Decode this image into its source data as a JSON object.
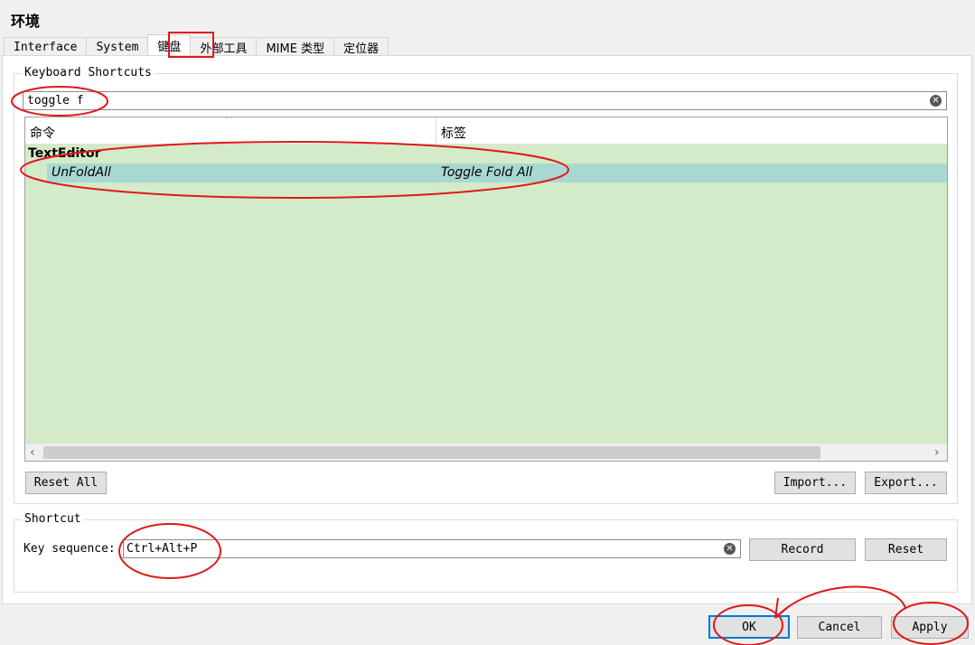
{
  "window": {
    "title": "环境"
  },
  "tabs": [
    {
      "label": "Interface",
      "active": false
    },
    {
      "label": "System",
      "active": false
    },
    {
      "label": "键盘",
      "active": true
    },
    {
      "label": "外部工具",
      "active": false
    },
    {
      "label": "MIME 类型",
      "active": false
    },
    {
      "label": "定位器",
      "active": false
    }
  ],
  "shortcuts_group": {
    "title": "Keyboard Shortcuts",
    "search_value": "toggle f",
    "columns": [
      "命令",
      "标签"
    ],
    "tree": {
      "group": "TextEditor",
      "rows": [
        {
          "command": "UnFoldAll",
          "label": "Toggle Fold All",
          "selected": true
        }
      ]
    },
    "reset_all": "Reset All",
    "import": "Import...",
    "export": "Export..."
  },
  "shortcut_group": {
    "title": "Shortcut",
    "key_sequence_label": "Key sequence:",
    "key_sequence_value": "Ctrl+Alt+P",
    "record": "Record",
    "reset": "Reset"
  },
  "dialog_buttons": {
    "ok": "OK",
    "cancel": "Cancel",
    "apply": "Apply"
  },
  "colors": {
    "tree_bg": "#d3ebc8",
    "selected_row": "#a8d8d2",
    "annotation": "#e01818",
    "focus_border": "#0078d7"
  },
  "icons": [
    "clear-search-icon",
    "sort-ascending-icon",
    "scroll-left-icon",
    "scroll-right-icon",
    "clear-keyseq-icon"
  ]
}
